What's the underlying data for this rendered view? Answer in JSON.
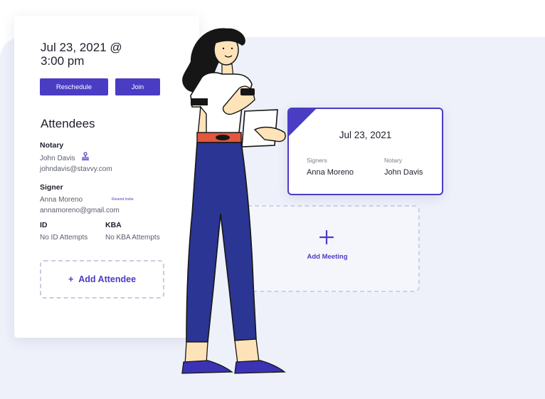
{
  "meeting_details": {
    "datetime": "Jul 23, 2021 @ 3:00 pm",
    "reschedule_label": "Reschedule",
    "join_label": "Join",
    "attendees_title": "Attendees",
    "notary": {
      "role": "Notary",
      "name": "John Davis",
      "email": "johndavis@stavvy.com",
      "icon": "stamp-icon"
    },
    "signer": {
      "role": "Signer",
      "name": "Anna Moreno",
      "email": "annamoreno@gmail.com",
      "resend_label": "Resend Invite"
    },
    "id": {
      "label": "ID",
      "value": "No ID Attempts"
    },
    "kba": {
      "label": "KBA",
      "value": "No KBA Attempts"
    },
    "add_attendee_icon": "+",
    "add_attendee_label": "Add Attendee"
  },
  "meeting_card": {
    "date": "Jul 23, 2021",
    "signers_label": "Signers",
    "signer_name": "Anna Moreno",
    "notary_label": "Notary",
    "notary_name": "John Davis"
  },
  "add_meeting": {
    "label": "Add Meeting",
    "icon": "plus-icon"
  },
  "colors": {
    "accent": "#4b3cc4",
    "background_panel": "#eef1fa",
    "pants": "#2b3593",
    "hair": "#161616",
    "skin": "#ffe3b8",
    "belt": "#e2573e"
  }
}
